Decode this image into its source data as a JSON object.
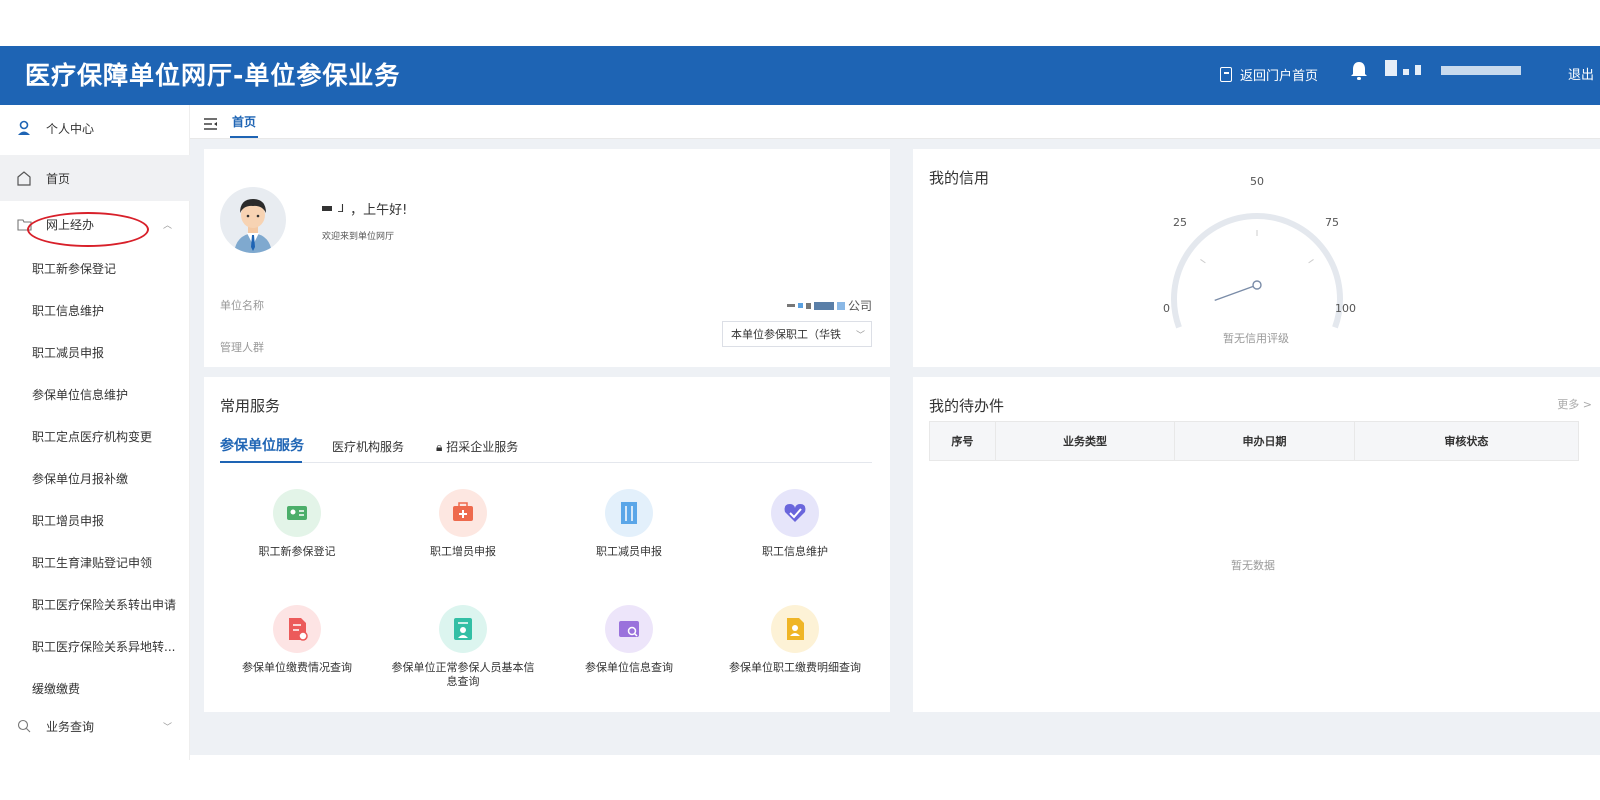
{
  "header": {
    "title": "医疗保障单位网厅-单位参保业务",
    "portal_link": "返回门户首页",
    "logout": "退出"
  },
  "tabs": {
    "home": "首页"
  },
  "sidebar": {
    "personal_center": "个人中心",
    "home": "首页",
    "online_handling": "网上经办",
    "sub_items": [
      "职工新参保登记",
      "职工信息维护",
      "职工减员申报",
      "参保单位信息维护",
      "职工定点医疗机构变更",
      "参保单位月报补缴",
      "职工增员申报",
      "职工生育津贴登记申领",
      "职工医疗保险关系转出申请",
      "职工医疗保险关系异地转...",
      "缓缴缴费"
    ],
    "business_query": "业务查询"
  },
  "welcome": {
    "greeting": "，上午好!",
    "subtitle": "欢迎来到单位网厅",
    "unit_name_label": "单位名称",
    "company_suffix": "公司",
    "manage_group_label": "管理人群",
    "manage_group_value": "本单位参保职工（华铁"
  },
  "credit": {
    "title": "我的信用",
    "gauge_value": 0,
    "gauge_min": 0,
    "gauge_max": 100,
    "ticks": [
      "0",
      "25",
      "50",
      "75",
      "100"
    ],
    "note": "暂无信用评级"
  },
  "services": {
    "title": "常用服务",
    "tabs": [
      "参保单位服务",
      "医疗机构服务",
      "招采企业服务"
    ],
    "items": [
      {
        "name": "职工新参保登记",
        "icon": "id-card-icon",
        "color": "#4cae6a",
        "bg": "#e3f4e8"
      },
      {
        "name": "职工增员申报",
        "icon": "medkit-icon",
        "color": "#ee6a4d",
        "bg": "#fde7e1"
      },
      {
        "name": "职工减员申报",
        "icon": "building-icon",
        "color": "#5aa6e8",
        "bg": "#e3f0fb"
      },
      {
        "name": "职工信息维护",
        "icon": "heart-icon",
        "color": "#6a66dc",
        "bg": "#e6e5fa"
      },
      {
        "name": "参保单位缴费情况查询",
        "icon": "document-icon",
        "color": "#ec5a5a",
        "bg": "#fde4e4"
      },
      {
        "name": "参保单位正常参保人员基本信息查询",
        "icon": "profile-icon",
        "color": "#33bfa5",
        "bg": "#dcf5ef"
      },
      {
        "name": "参保单位信息查询",
        "icon": "wallet-search-icon",
        "color": "#9a72dc",
        "bg": "#ede5fa"
      },
      {
        "name": "参保单位职工缴费明细查询",
        "icon": "file-user-icon",
        "color": "#efb526",
        "bg": "#fdf2d6"
      }
    ]
  },
  "todo": {
    "title": "我的待办件",
    "more": "更多 >",
    "columns": [
      "序号",
      "业务类型",
      "申办日期",
      "审核状态"
    ],
    "empty": "暂无数据"
  }
}
